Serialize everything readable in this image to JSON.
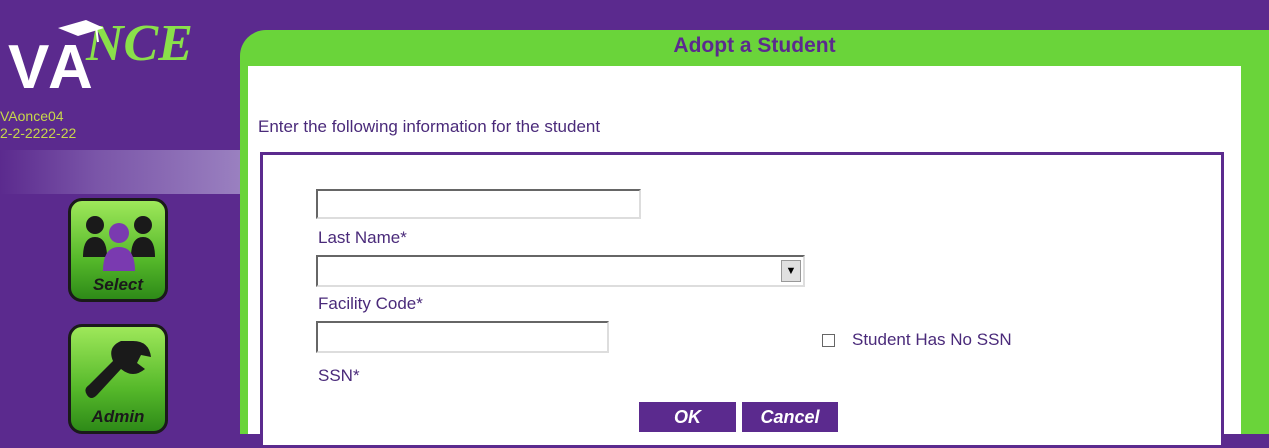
{
  "sidebar": {
    "logo_text": "VANCE",
    "username": "VAonce04",
    "user_id": "2-2-2222-22",
    "nav": [
      {
        "label": "Select",
        "icon": "people-icon"
      },
      {
        "label": "Admin",
        "icon": "wrench-icon"
      }
    ]
  },
  "page": {
    "title": "Adopt a Student",
    "instruction": "Enter the following information for the student"
  },
  "form": {
    "last_name": {
      "label": "Last Name*",
      "value": ""
    },
    "facility_code": {
      "label": "Facility Code*",
      "value": ""
    },
    "ssn": {
      "label": "SSN*",
      "value": ""
    },
    "no_ssn": {
      "label": "Student Has No SSN",
      "checked": false
    }
  },
  "buttons": {
    "ok": "OK",
    "cancel": "Cancel"
  },
  "colors": {
    "purple": "#5b2a8e",
    "green": "#6ad43a",
    "label": "#4a2a7a"
  }
}
